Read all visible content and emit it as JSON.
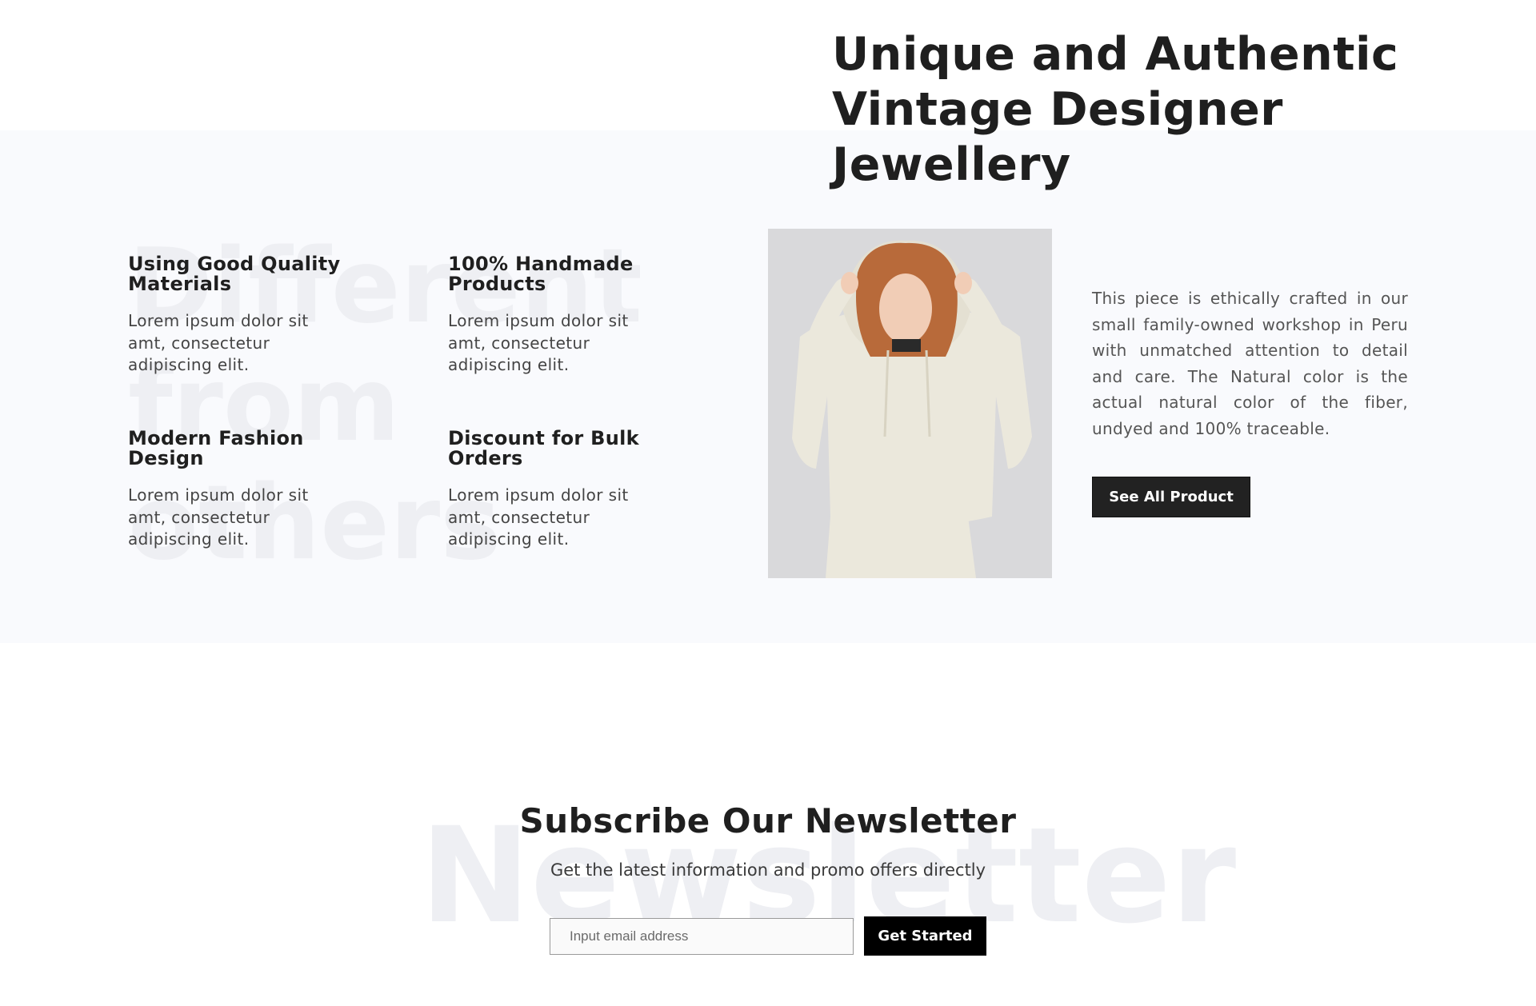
{
  "hero": {
    "title": "Unique and Authentic Vintage Designer Jewellery"
  },
  "features": {
    "watermark": "Different\nfrom\nothers",
    "items": [
      {
        "title": "Using Good Quality Materials",
        "text": "Lorem ipsum dolor sit amt, consectetur adipiscing elit."
      },
      {
        "title": "100% Handmade Products",
        "text": "Lorem ipsum dolor sit amt, consectetur adipiscing elit."
      },
      {
        "title": "Modern Fashion Design",
        "text": "Lorem ipsum dolor sit amt, consectetur adipiscing elit."
      },
      {
        "title": "Discount for Bulk Orders",
        "text": "Lorem ipsum dolor sit amt, consectetur adipiscing elit."
      }
    ]
  },
  "product": {
    "description": "This piece is ethically crafted in our small family-owned workshop in Peru with unmatched attention to detail and care. The Natural color is the actual natural color of the fiber, undyed and 100% traceable.",
    "button_label": "See All Product"
  },
  "newsletter": {
    "watermark": "Newsletter",
    "title": "Subscribe Our Newsletter",
    "subtitle": "Get the latest information and promo offers directly",
    "email_placeholder": "Input email address",
    "button_label": "Get Started"
  },
  "colors": {
    "band_background": "#f9fafd",
    "button_dark": "#1f1f1f",
    "watermark": "#eeeff3"
  }
}
